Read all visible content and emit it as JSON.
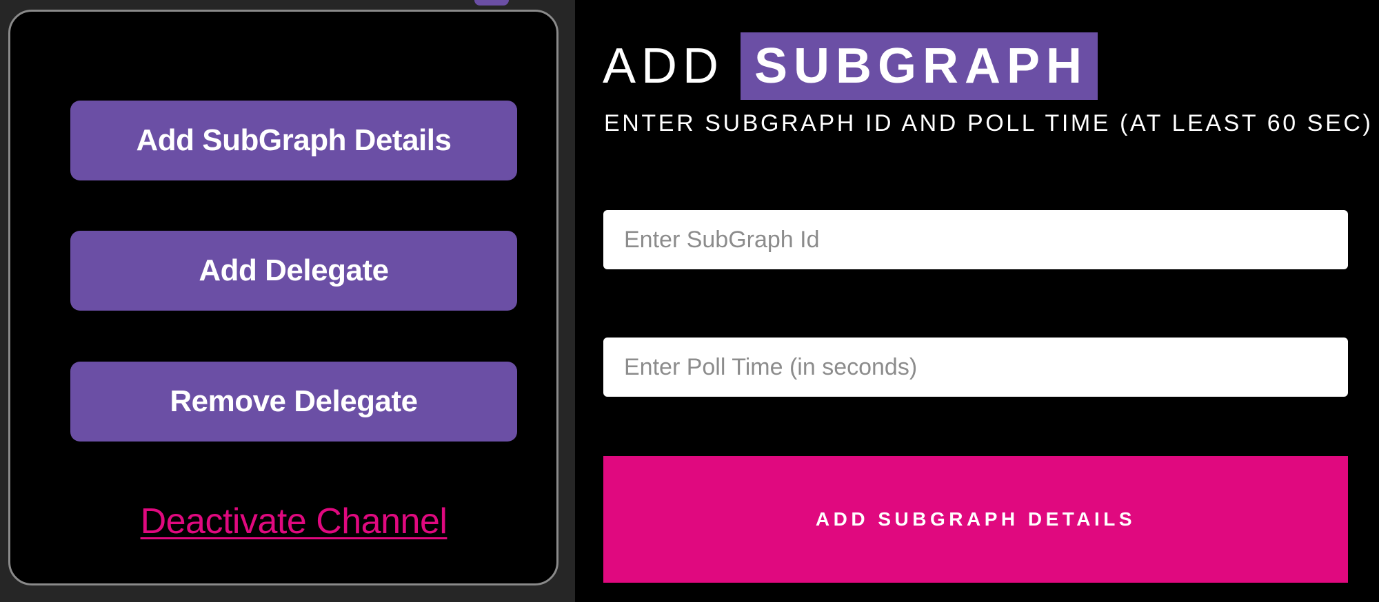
{
  "menu": {
    "add_subgraph_details_label": "Add SubGraph Details",
    "add_delegate_label": "Add Delegate",
    "remove_delegate_label": "Remove Delegate",
    "deactivate_channel_label": "Deactivate Channel"
  },
  "form": {
    "title_prefix": "ADD",
    "title_highlight": "SUBGRAPH",
    "subtitle": "ENTER SUBGRAPH ID AND POLL TIME (AT LEAST 60 SEC)",
    "subgraph_id": {
      "value": "",
      "placeholder": "Enter SubGraph Id"
    },
    "poll_time": {
      "value": "",
      "placeholder": "Enter Poll Time (in seconds)"
    },
    "submit_label": "ADD SUBGRAPH DETAILS"
  },
  "colors": {
    "primary_purple": "#6b4fa5",
    "accent_pink": "#e0097f",
    "background": "#000000",
    "card_border": "#8a8a8a"
  }
}
